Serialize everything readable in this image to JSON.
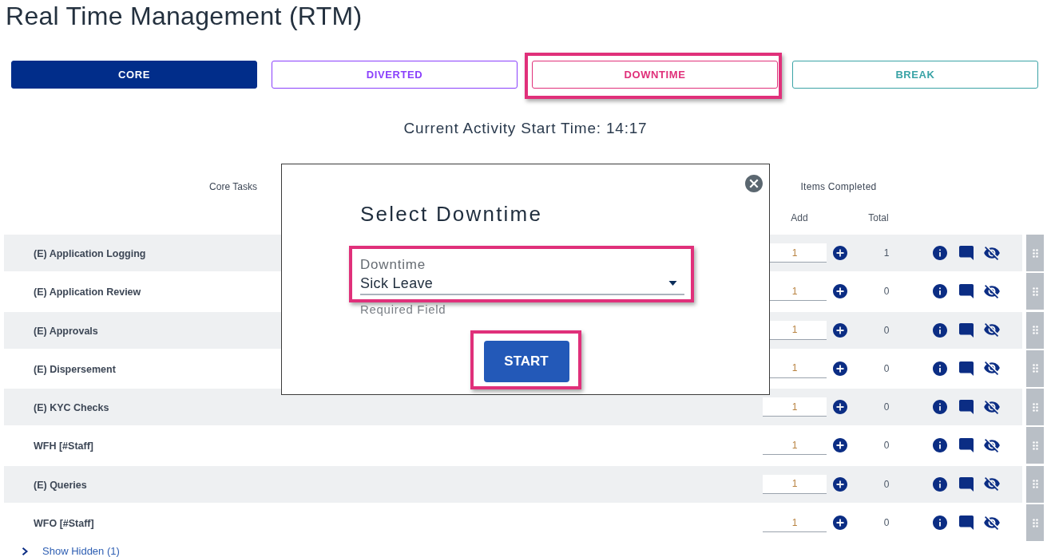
{
  "page": {
    "title": "Real Time Management (RTM)"
  },
  "tabs": [
    {
      "label": "CORE",
      "selected": true,
      "color": "#012d8a",
      "highlighted": false
    },
    {
      "label": "DIVERTED",
      "selected": false,
      "color": "#8a3ffc",
      "highlighted": false
    },
    {
      "label": "DOWNTIME",
      "selected": false,
      "color": "#e0307a",
      "highlighted": true
    },
    {
      "label": "BREAK",
      "selected": false,
      "color": "#3aa3a6",
      "highlighted": false
    }
  ],
  "activity": {
    "text": "Current Activity Start Time: 14:17"
  },
  "table": {
    "columns": {
      "task": "Core Tasks",
      "items_completed": "Items Completed",
      "add": "Add",
      "total": "Total"
    },
    "rows": [
      {
        "task": "(E) Application Logging",
        "add": "1",
        "total": "1"
      },
      {
        "task": "(E) Application Review",
        "add": "1",
        "total": "0"
      },
      {
        "task": "(E) Approvals",
        "add": "1",
        "total": "0"
      },
      {
        "task": "(E) Dispersement",
        "add": "1",
        "total": "0"
      },
      {
        "task": "(E) KYC Checks",
        "add": "1",
        "total": "0"
      },
      {
        "task": "WFH [#Staff]",
        "add": "1",
        "total": "0"
      },
      {
        "task": "(E) Queries",
        "add": "1",
        "total": "0"
      },
      {
        "task": "WFO [#Staff]",
        "add": "1",
        "total": "0"
      }
    ]
  },
  "show_hidden": {
    "label": "Show Hidden (1)",
    "expanded": false
  },
  "dialog": {
    "title": "Select Downtime",
    "field": {
      "label": "Downtime",
      "value": "Sick Leave",
      "helper": "Required Field",
      "highlighted": true
    },
    "start_button": {
      "label": "START",
      "highlighted": true
    }
  }
}
